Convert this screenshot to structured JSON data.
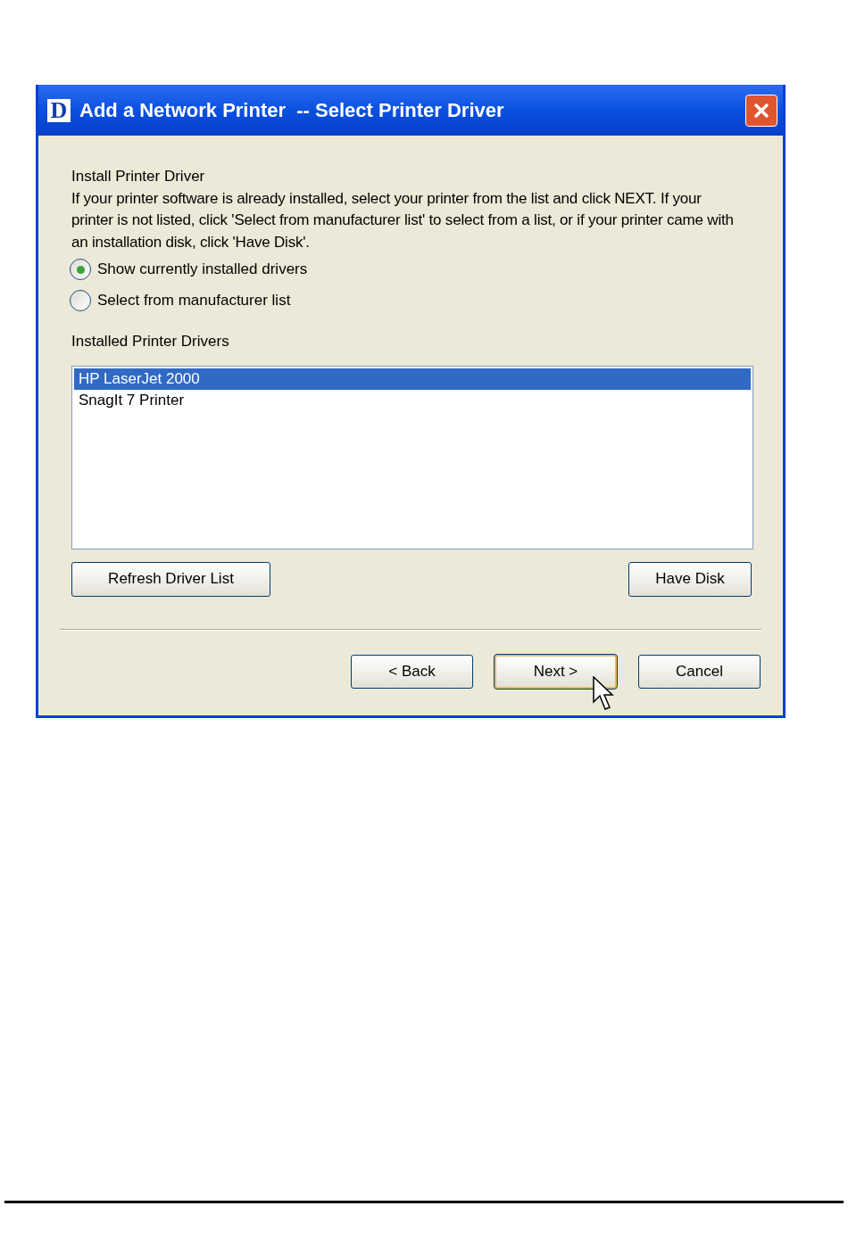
{
  "window": {
    "logo": "D",
    "title": "Add a Network Printer  -- Select Printer Driver"
  },
  "heading": "Install Printer Driver",
  "instructions": "If your printer software is already installed, select your printer from the list and click NEXT. If your printer is not listed, click 'Select from manufacturer list' to select from a list, or if your printer came with an installation disk, click 'Have Disk'.",
  "options": [
    {
      "label": "Show currently installed drivers",
      "selected": true
    },
    {
      "label": "Select from manufacturer list",
      "selected": false
    }
  ],
  "list": {
    "label": "Installed Printer Drivers",
    "items": [
      {
        "label": "HP LaserJet 2000",
        "selected": true
      },
      {
        "label": "SnagIt 7 Printer",
        "selected": false
      }
    ]
  },
  "list_buttons": [
    "Refresh Driver List",
    "Have Disk"
  ],
  "nav_buttons": [
    {
      "label": "< Back",
      "focused": false
    },
    {
      "label": "Next >",
      "focused": true
    },
    {
      "label": "Cancel",
      "focused": false
    }
  ]
}
